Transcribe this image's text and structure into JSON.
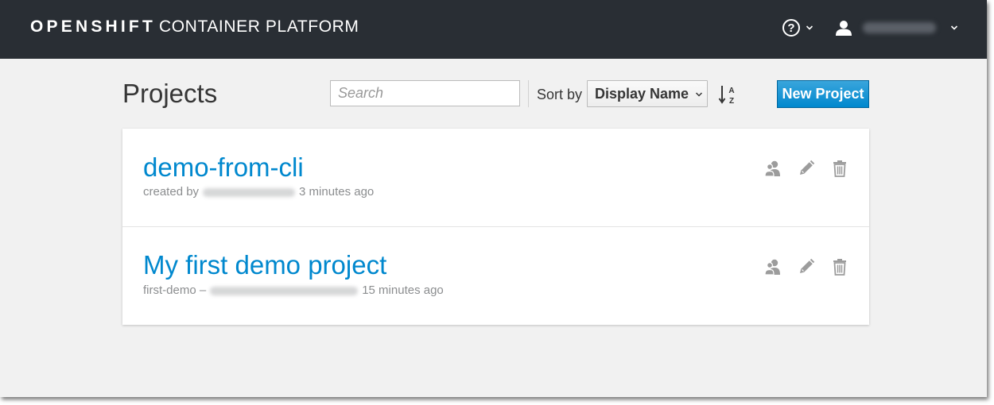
{
  "masthead": {
    "brand_bold": "OPENSHIFT",
    "brand_light": "CONTAINER PLATFORM"
  },
  "page": {
    "title": "Projects"
  },
  "toolbar": {
    "search_placeholder": "Search",
    "sort_label": "Sort by",
    "sort_value": "Display Name",
    "new_project_label": "New Project"
  },
  "projects": [
    {
      "display_name": "demo-from-cli",
      "meta_prefix": "created by",
      "meta_age": "3 minutes ago"
    },
    {
      "display_name": "My first demo project",
      "meta_prefix": "first-demo –",
      "meta_age": "15 minutes ago"
    }
  ],
  "colors": {
    "masthead": "#292e34",
    "background": "#f1f1f1",
    "link": "#0088ce",
    "primary_button": "#0088ce",
    "icon": "#9c9c9c"
  },
  "icons": [
    "help-icon",
    "user-icon",
    "chevron-down-icon",
    "sort-alpha-asc-icon",
    "members-icon",
    "edit-icon",
    "trash-icon"
  ]
}
